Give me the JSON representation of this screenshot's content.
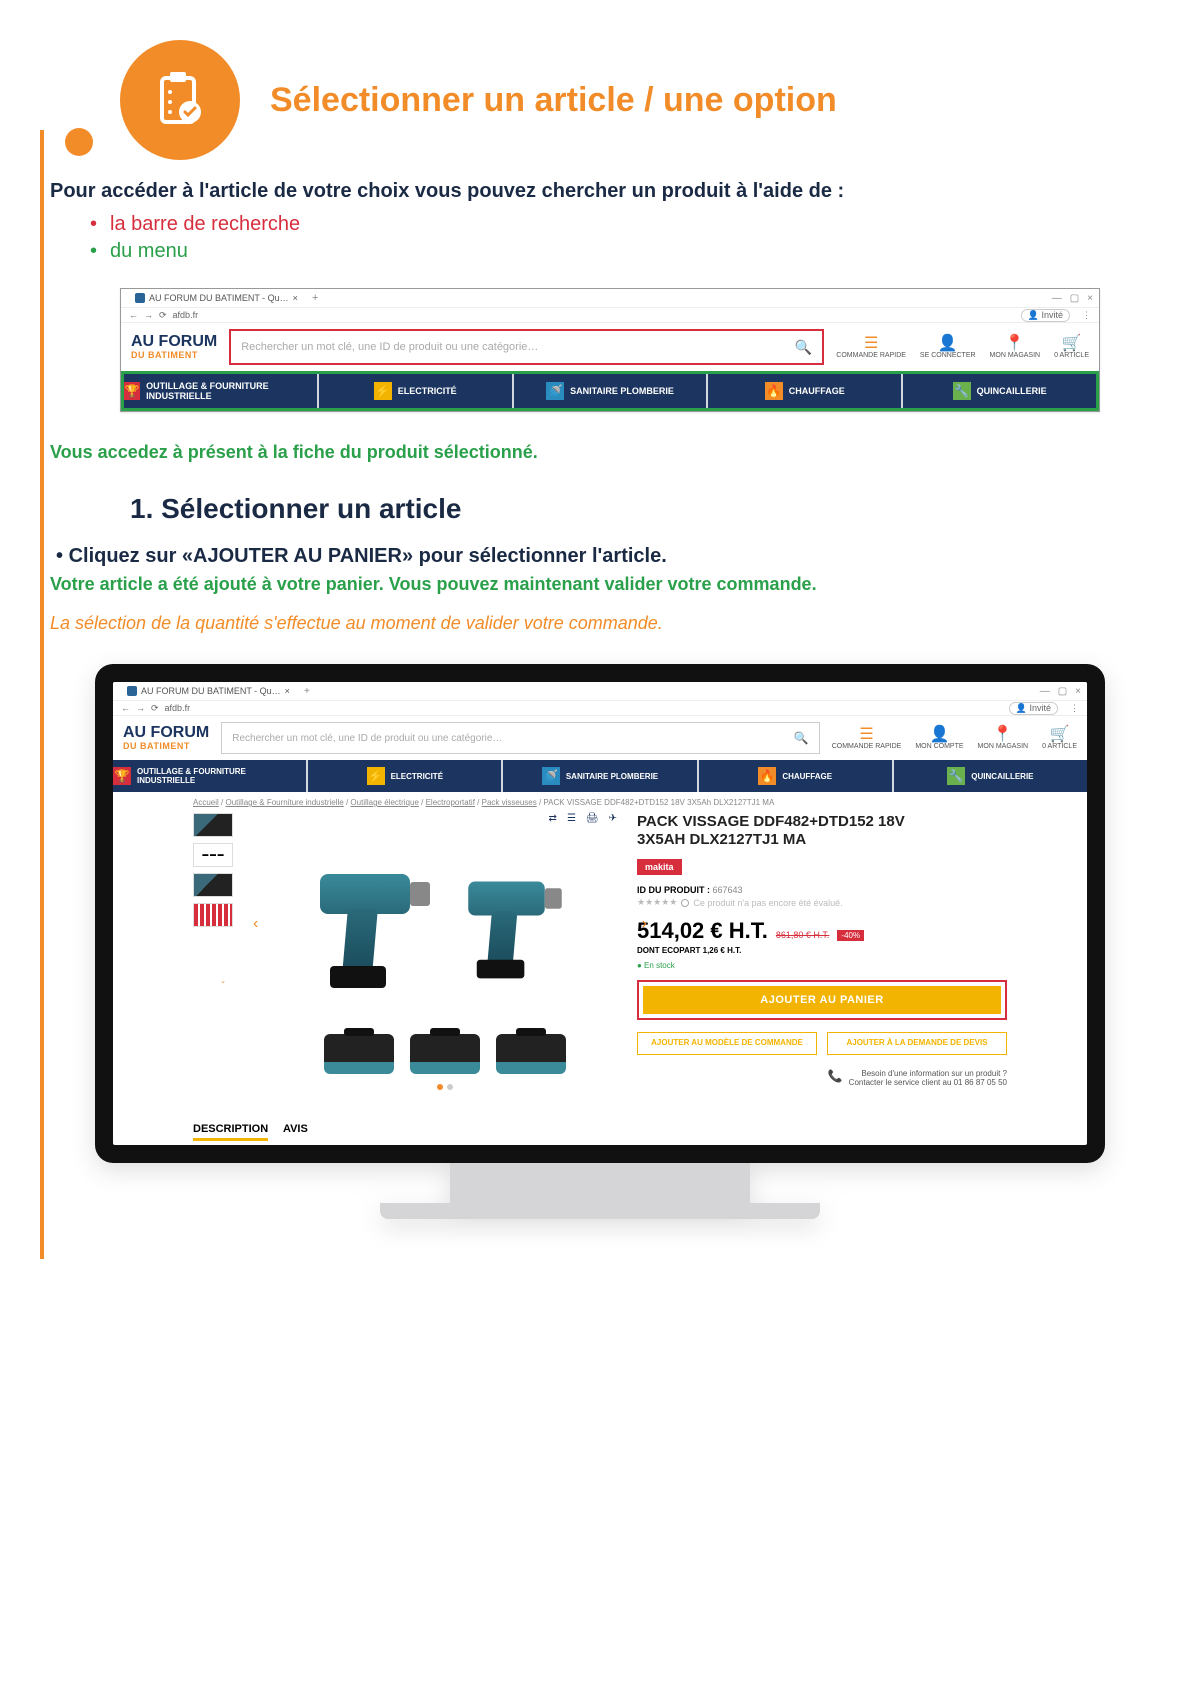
{
  "header": {
    "title": "Sélectionner un article / une option"
  },
  "intro": {
    "lead": "Pour accéder à l'article de votre choix vous pouvez chercher un produit à l'aide de :",
    "li_search": "la barre de recherche",
    "li_menu": "du menu"
  },
  "browser": {
    "tab_title": "AU FORUM DU BATIMENT - Qu…",
    "url": "afdb.fr",
    "win_min": "—",
    "win_max": "▢",
    "win_close": "×",
    "invite": "Invité"
  },
  "site": {
    "logo_top": "AU FORUM",
    "logo_sub": "DU BATIMENT",
    "search_placeholder": "Rechercher un mot clé, une ID de produit ou une catégorie…",
    "util": {
      "quick": "COMMANDE RAPIDE",
      "account": "SE CONNECTER",
      "account2": "MON COMPTE",
      "store": "MON MAGASIN",
      "cart": "0 ARTICLE"
    },
    "menu": {
      "m1": "OUTILLAGE & FOURNITURE INDUSTRIELLE",
      "m2": "ELECTRICITÉ",
      "m3": "SANITAIRE PLOMBERIE",
      "m4": "CHAUFFAGE",
      "m5": "QUINCAILLERIE"
    }
  },
  "mid": {
    "access_line": "Vous accedez à présent à la fiche du produit sélectionné.",
    "heading": "1. Sélectionner un article",
    "step": "Cliquez sur «AJOUTER AU PANIER» pour sélectionner l'article.",
    "added": "Votre article a été ajouté à votre panier. Vous pouvez maintenant valider votre commande.",
    "note": "La sélection de la quantité s'effectue au moment de valider votre commande."
  },
  "product": {
    "breadcrumb": {
      "a": "Accueil",
      "b": "Outillage & Fourniture industrielle",
      "c": "Outillage électrique",
      "d": "Electroportatif",
      "e": "Pack visseuses",
      "current": "PACK VISSAGE DDF482+DTD152 18V 3X5Ah DLX2127TJ1 MA"
    },
    "name_l1": "PACK VISSAGE DDF482+DTD152 18V",
    "name_l2": "3X5AH DLX2127TJ1 MA",
    "brand": "makita",
    "pid_label": "ID DU PRODUIT :",
    "pid_val": "667643",
    "rating_text": "Ce produit n'a pas encore été évalué.",
    "price": "514,02 € H.T.",
    "price_old": "861,80 € H.T.",
    "discount": "-40%",
    "ecopart": "DONT ECOPART 1,26 € H.T.",
    "stock": "● En stock",
    "add_cart": "AJOUTER AU PANIER",
    "btn_model": "AJOUTER AU MODÈLE DE COMMANDE",
    "btn_quote": "AJOUTER À LA DEMANDE DE DEVIS",
    "contact_l1": "Besoin d'une information sur un produit ?",
    "contact_l2": "Contacter le service client au 01 86 87 05 50",
    "tab_desc": "DESCRIPTION",
    "tab_reviews": "AVIS"
  }
}
